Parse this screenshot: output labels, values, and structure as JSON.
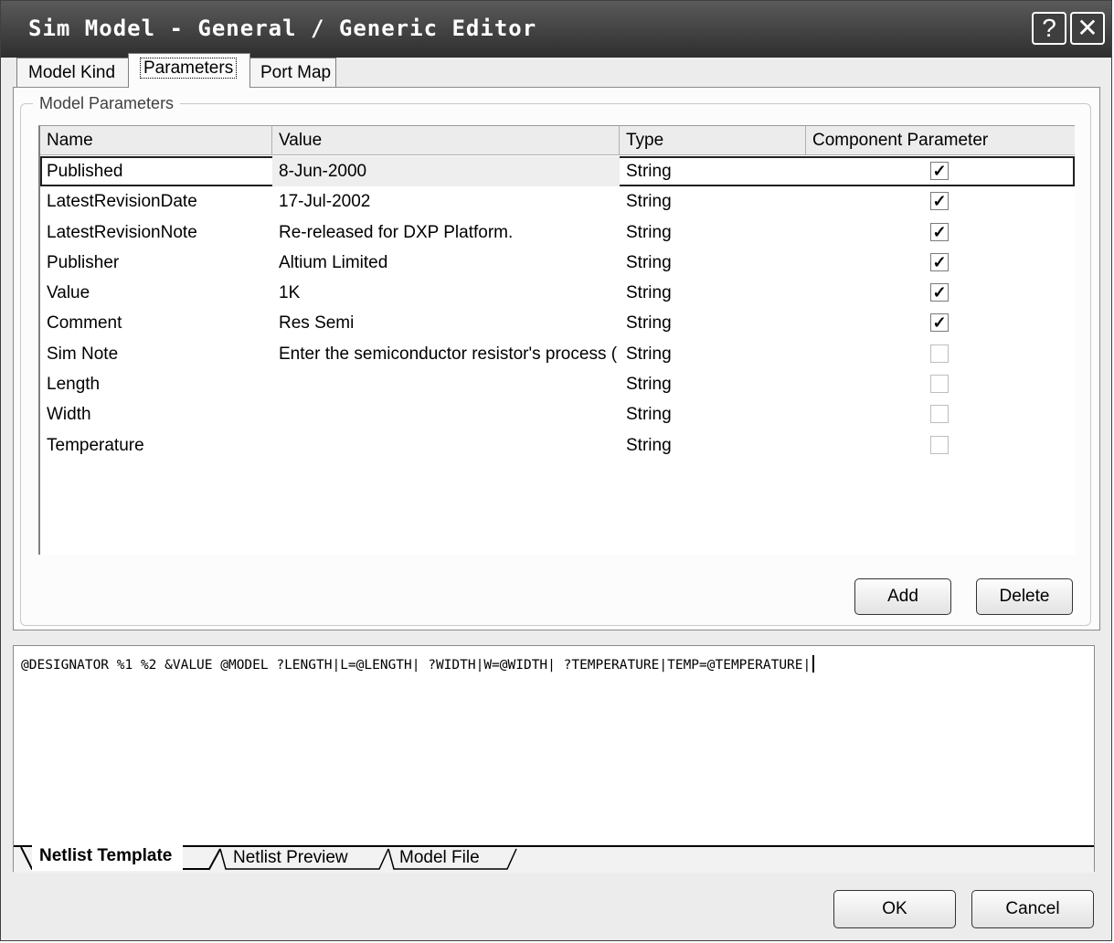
{
  "window": {
    "title": "Sim Model - General / Generic Editor"
  },
  "titlebar": {
    "help_label": "?",
    "close_label": "✕"
  },
  "tabs": [
    {
      "label": "Model Kind"
    },
    {
      "label": "Parameters"
    },
    {
      "label": "Port Map"
    }
  ],
  "group": {
    "legend": "Model Parameters"
  },
  "grid": {
    "columns": [
      "Name",
      "Value",
      "Type",
      "Component Parameter"
    ],
    "rows": [
      {
        "name": "Published",
        "value": "8-Jun-2000",
        "type": "String",
        "checked": true
      },
      {
        "name": "LatestRevisionDate",
        "value": "17-Jul-2002",
        "type": "String",
        "checked": true
      },
      {
        "name": "LatestRevisionNote",
        "value": "Re-released for DXP Platform.",
        "type": "String",
        "checked": true
      },
      {
        "name": "Publisher",
        "value": "Altium Limited",
        "type": "String",
        "checked": true
      },
      {
        "name": "Value",
        "value": "1K",
        "type": "String",
        "checked": true
      },
      {
        "name": "Comment",
        "value": "Res Semi",
        "type": "String",
        "checked": true
      },
      {
        "name": "Sim Note",
        "value": "Enter the semiconductor resistor's process (",
        "type": "String",
        "checked": false
      },
      {
        "name": "Length",
        "value": "",
        "type": "String",
        "checked": false
      },
      {
        "name": "Width",
        "value": "",
        "type": "String",
        "checked": false
      },
      {
        "name": "Temperature",
        "value": "",
        "type": "String",
        "checked": false
      }
    ],
    "selected_row": 0
  },
  "buttons": {
    "add": "Add",
    "delete": "Delete",
    "ok": "OK",
    "cancel": "Cancel"
  },
  "netlist": {
    "template": "@DESIGNATOR %1 %2 &VALUE @MODEL ?LENGTH|L=@LENGTH| ?WIDTH|W=@WIDTH| ?TEMPERATURE|TEMP=@TEMPERATURE|",
    "tabs": [
      "Netlist Template",
      "Netlist Preview",
      "Model File"
    ]
  },
  "colors": {
    "titlebar": "#3a3a3a",
    "dialog": "#ececec"
  }
}
